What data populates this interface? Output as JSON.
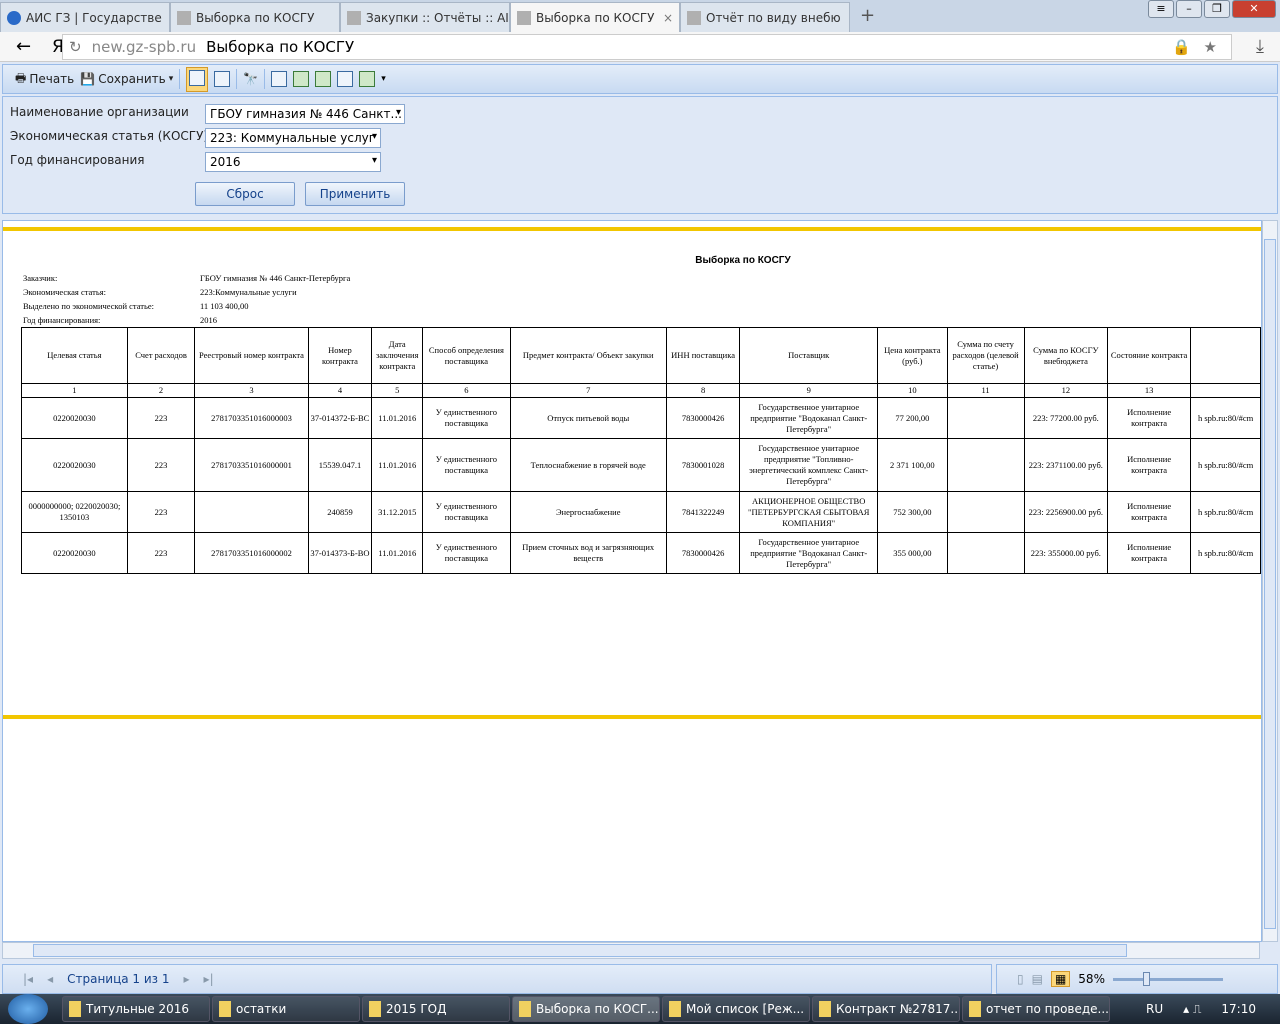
{
  "browser": {
    "tabs": [
      {
        "label": "АИС ГЗ | Государстве",
        "active": false
      },
      {
        "label": "Выборка по КОСГУ",
        "active": false
      },
      {
        "label": "Закупки :: Отчёты :: АІ",
        "active": false
      },
      {
        "label": "Выборка по КОСГУ",
        "active": true
      },
      {
        "label": "Отчёт по виду внебю",
        "active": false
      }
    ],
    "new_tab": "+",
    "close_tab": "×",
    "host": "new.gz-spb.ru",
    "page_title": "Выборка по КОСГУ",
    "yandex": "Я"
  },
  "toolbar": {
    "print": "Печать",
    "save": "Сохранить"
  },
  "filters": {
    "org_label": "Наименование организации",
    "org_value": "ГБОУ гимназия № 446 Санкт...",
    "kosgu_label": "Экономическая статья (КОСГУ)",
    "kosgu_value": "223: Коммунальные услуг",
    "year_label": "Год финансирования",
    "year_value": "2016",
    "reset": "Сброс",
    "apply": "Применить"
  },
  "report": {
    "title": "Выборка по КОСГУ",
    "meta": [
      {
        "label": "Заказчик:",
        "value": "ГБОУ гимназия № 446 Санкт-Петербурга"
      },
      {
        "label": "Экономическая статья:",
        "value": "223:Коммунальные услуги"
      },
      {
        "label": "Выделено по экономической статье:",
        "value": "11 103 400,00"
      },
      {
        "label": "Год финансирования:",
        "value": "2016"
      }
    ],
    "columns": [
      "Целевая статья",
      "Счет расходов",
      "Реестровый номер контракта",
      "Номер контракта",
      "Дата заключения контракта",
      "Способ определения поставщика",
      "Предмет контракта/ Объект закупки",
      "ИНН поставщика",
      "Поставщик",
      "Цена контракта (руб.)",
      "Сумма по счету расходов (целевой статье)",
      "Сумма по КОСГУ внебюджета",
      "Состояние контракта",
      ""
    ],
    "column_numbers": [
      "1",
      "2",
      "3",
      "4",
      "5",
      "6",
      "7",
      "8",
      "9",
      "10",
      "11",
      "12",
      "13",
      ""
    ],
    "rows": [
      [
        "0220020030",
        "223",
        "2781703351016000003",
        "37-014372-Б-ВС",
        "11.01.2016",
        "У единственного поставщика",
        "Отпуск питьевой воды",
        "7830000426",
        "Государственное унитарное предприятие \"Водоканал Санкт-Петербурга\"",
        "77 200,00",
        "",
        "223: 77200.00 руб.",
        "Исполнение контракта",
        "h spb.ru:80/#cm"
      ],
      [
        "0220020030",
        "223",
        "2781703351016000001",
        "15539.047.1",
        "11.01.2016",
        "У единственного поставщика",
        "Теплоснабжение в горячей воде",
        "7830001028",
        "Государственное унитарное предприятие \"Топливно-энергетический комплекс Санкт-Петербурга\"",
        "2 371 100,00",
        "",
        "223: 2371100.00 руб.",
        "Исполнение контракта",
        "h spb.ru:80/#cm"
      ],
      [
        "0000000000; 0220020030; 1350103",
        "223",
        "",
        "240859",
        "31.12.2015",
        "У единственного поставщика",
        "Энергоснабжение",
        "7841322249",
        "АКЦИОНЕРНОЕ ОБЩЕСТВО \"ПЕТЕРБУРГСКАЯ СБЫТОВАЯ КОМПАНИЯ\"",
        "752 300,00",
        "",
        "223: 2256900.00 руб.",
        "Исполнение контракта",
        "h spb.ru:80/#cm"
      ],
      [
        "0220020030",
        "223",
        "2781703351016000002",
        "37-014373-Б-ВО",
        "11.01.2016",
        "У единственного поставщика",
        "Прием сточных вод и загрязняющих веществ",
        "7830000426",
        "Государственное унитарное предприятие \"Водоканал Санкт-Петербурга\"",
        "355 000,00",
        "",
        "223: 355000.00 руб.",
        "Исполнение контракта",
        "h spb.ru:80/#cm"
      ]
    ]
  },
  "pager": {
    "page_text": "Страница 1 из 1",
    "zoom": "58%",
    "zoom_percent": 58
  },
  "taskbar": {
    "items": [
      {
        "label": "Титульные 2016"
      },
      {
        "label": "остатки"
      },
      {
        "label": "2015 ГОД"
      },
      {
        "label": "Выборка по КОСГ..."
      },
      {
        "label": "Мой список [Реж..."
      },
      {
        "label": "Контракт №27817..."
      },
      {
        "label": "отчет по проведе..."
      }
    ],
    "lang": "RU",
    "clock": "17:10"
  }
}
